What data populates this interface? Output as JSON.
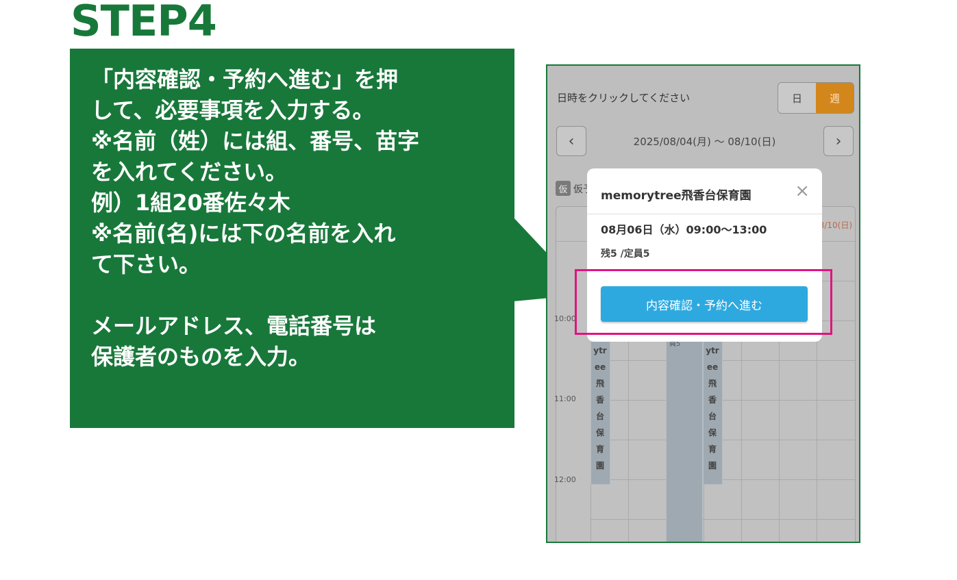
{
  "step": {
    "title": "STEP4"
  },
  "instructions": {
    "lines": [
      "「内容確認・予約へ進む」を押",
      "して、必要事項を入力する。",
      "※名前（姓）には組、番号、苗字",
      "を入れてください。",
      "例）1組20番佐々木",
      "※名前(名)には下の名前を入れ",
      "て下さい。",
      "",
      "メールアドレス、電話番号は",
      "保護者のものを入力。"
    ]
  },
  "screenshot": {
    "hint": "日時をクリックしてください",
    "view_toggle": {
      "day": "日",
      "week": "週"
    },
    "nav": {
      "prev_icon": "chevron-left-icon",
      "next_icon": "chevron-right-icon",
      "prev": "‹",
      "next": "›"
    },
    "date_range": "2025/08/04(月) 〜 08/10(日)",
    "legend": {
      "badge": "仮",
      "text": "仮予"
    },
    "header_date": "8/10(日)",
    "times": [
      "10:00",
      "11:00",
      "12:00"
    ],
    "event_left_text": "ytr\nee\n飛\n香\n台\n保\n育\n園",
    "event_right_text": "ytr\nee\n飛\n香\n台\n保\n育\n園",
    "event_mid_text": "員5",
    "popup": {
      "title": "memorytree飛香台保育園",
      "close": "×",
      "time": "08月06日（水）09:00〜13:00",
      "capacity": "残5 /定員5",
      "confirm_button": "内容確認・予約へ進む"
    }
  },
  "colors": {
    "green": "#18783a",
    "highlight": "#e2137f",
    "button_blue": "#2ea9e0",
    "week_orange": "#d3861a"
  }
}
